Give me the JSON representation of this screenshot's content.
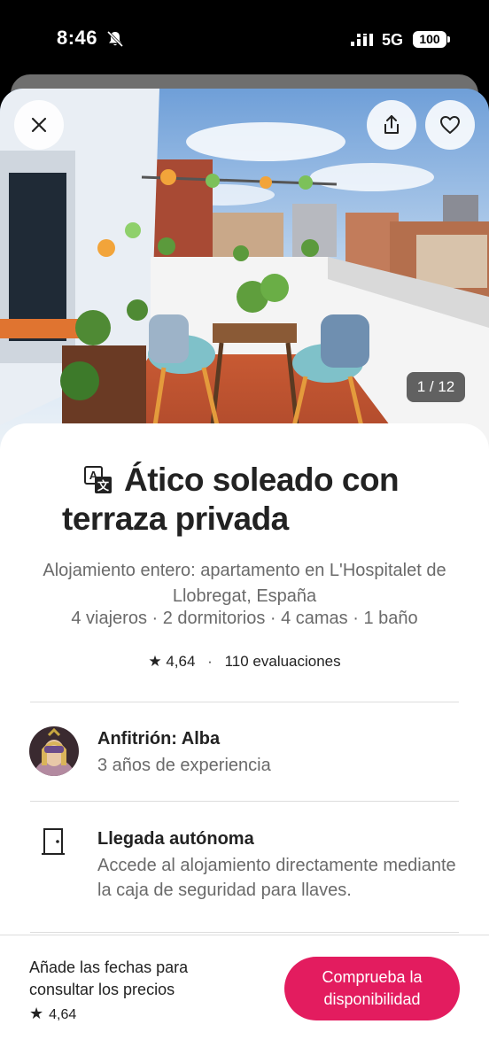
{
  "status_bar": {
    "time": "8:46",
    "network": "5G",
    "battery": "100"
  },
  "photo": {
    "counter": "1 / 12"
  },
  "listing": {
    "title": "Ático soleado con terraza privada",
    "subtitle": "Alojamiento entero: apartamento en L'Hospitalet de Llobregat, España",
    "details": "4 viajeros · 2 dormitorios · 4 camas · 1 baño",
    "rating": "4,64",
    "reviews": "110 evaluaciones"
  },
  "host": {
    "title": "Anfitrión: Alba",
    "experience": "3 años de experiencia"
  },
  "checkin": {
    "title": "Llegada autónoma",
    "description": "Accede al alojamiento directamente mediante la caja de seguridad para llaves."
  },
  "footer": {
    "prompt": "Añade las fechas para consultar los precios",
    "rating": "4,64",
    "cta": "Comprueba la disponibilidad"
  },
  "colors": {
    "brand": "#e31c5f",
    "text": "#222222",
    "muted": "#6a6a6a"
  },
  "icons": [
    "bell-off-icon",
    "signal-icon",
    "close-icon",
    "share-icon",
    "heart-icon",
    "translate-icon",
    "star-icon",
    "door-icon"
  ]
}
